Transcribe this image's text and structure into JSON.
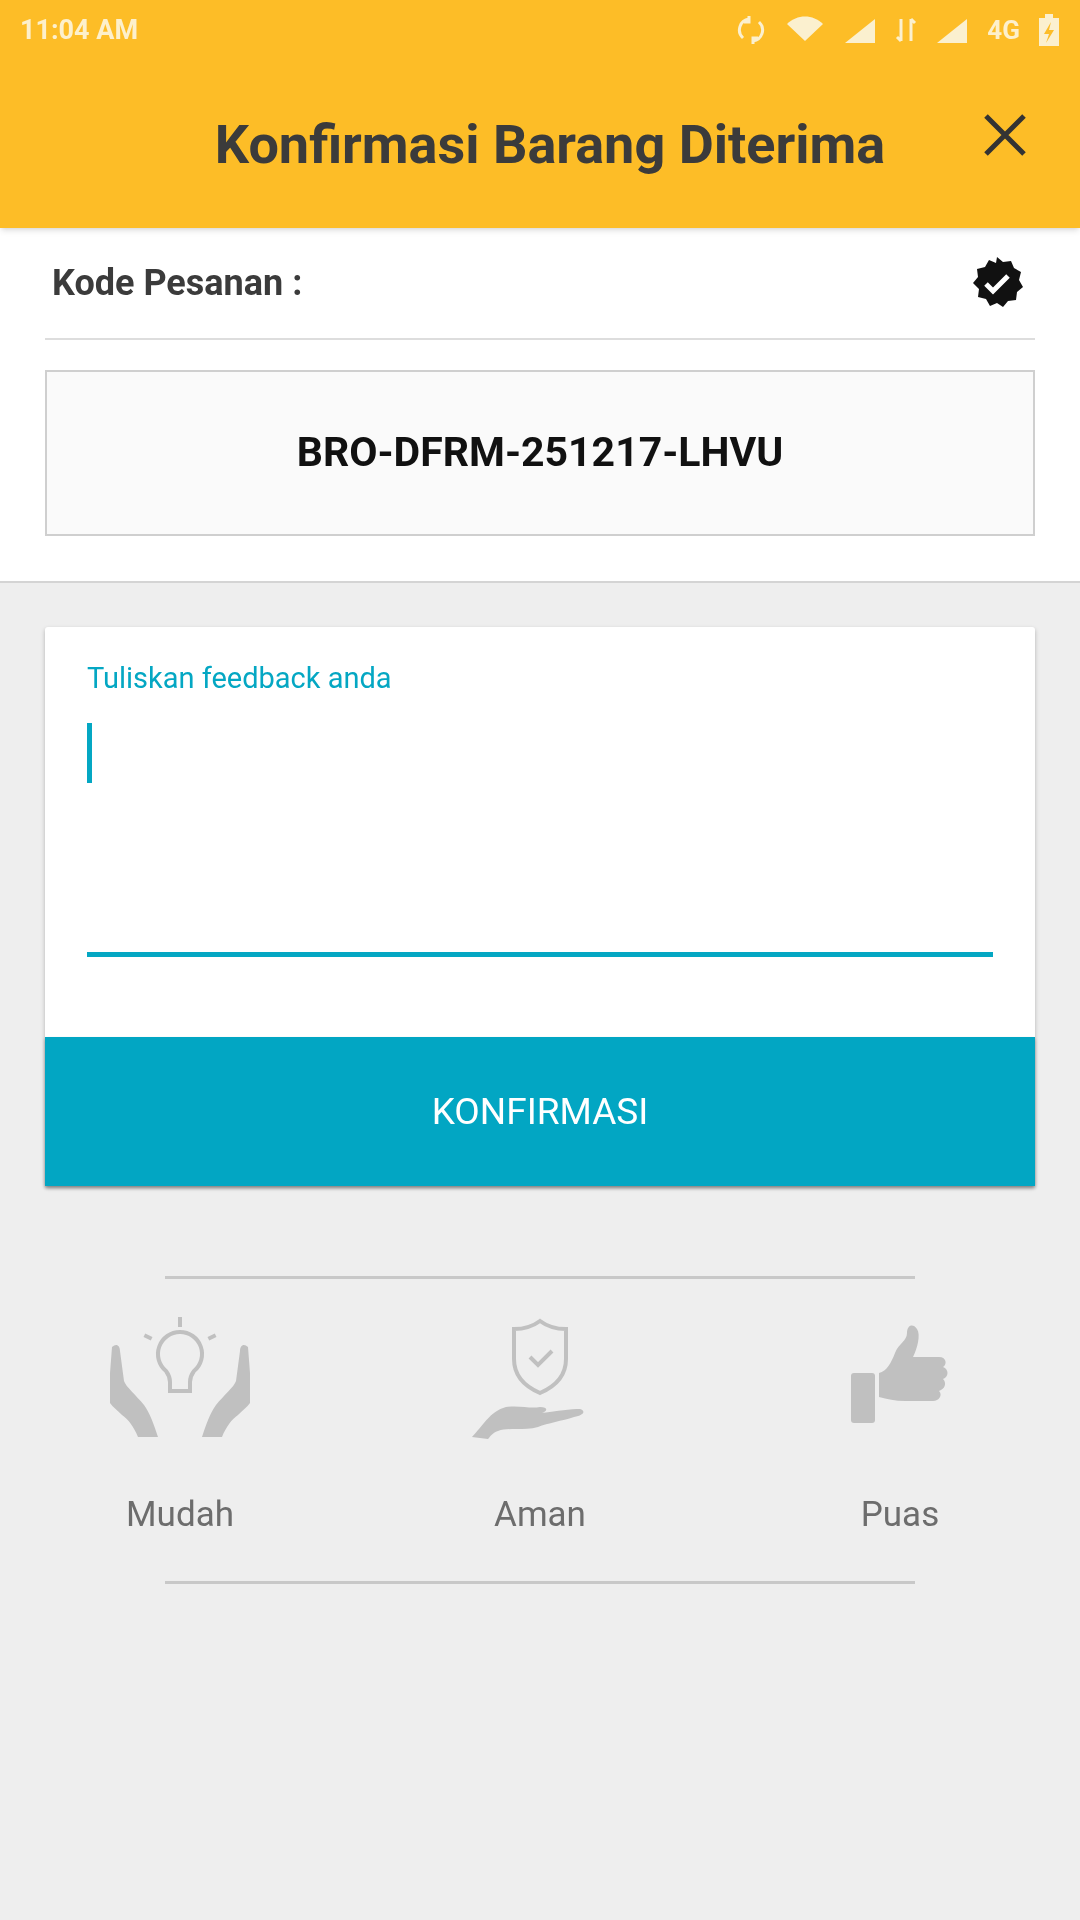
{
  "status_bar": {
    "time": "11:04 AM",
    "network": "4G"
  },
  "header": {
    "title": "Konfirmasi Barang Diterima"
  },
  "order": {
    "label": "Kode Pesanan :",
    "verified": true,
    "code": "BRO-DFRM-251217-LHVU"
  },
  "feedback": {
    "label": "Tuliskan feedback anda",
    "focused": true
  },
  "confirm_button": {
    "label": "KONFIRMASI"
  },
  "features": [
    {
      "kind": "hands-bulb",
      "label": "Mudah"
    },
    {
      "kind": "hand-shield",
      "label": "Aman"
    },
    {
      "kind": "thumbs-up",
      "label": "Puas"
    }
  ]
}
